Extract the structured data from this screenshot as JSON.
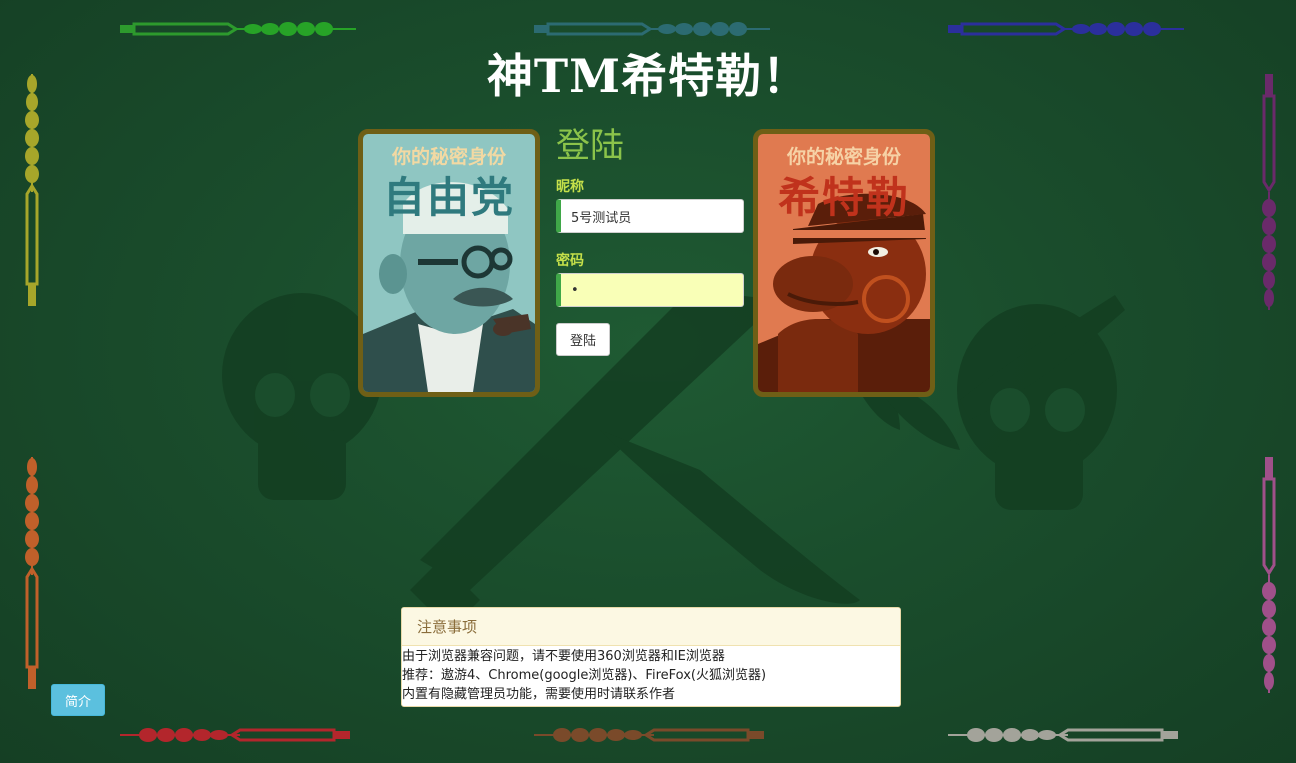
{
  "page": {
    "title": "神TM希特勒！"
  },
  "cards": {
    "liberal": {
      "subtitle": "你的秘密身份",
      "role": "自由党"
    },
    "hitler": {
      "subtitle": "你的秘密身份",
      "role": "希特勒"
    }
  },
  "login": {
    "heading": "登陆",
    "nickname_label": "昵称",
    "nickname_value": "5号测试员",
    "password_label": "密码",
    "password_value": "•",
    "submit_label": "登陆"
  },
  "notice": {
    "title": "注意事项",
    "lines": [
      "由于浏览器兼容问题，请不要使用360浏览器和IE浏览器",
      "推荐：遨游4、Chrome(google浏览器)、FireFox(火狐浏览器)",
      "内置有隐藏管理员功能，需要使用时请联系作者"
    ]
  },
  "intro_button": "简介",
  "colors": {
    "background": "#1a4d2c",
    "title": "#ffffff",
    "login_heading": "#8bc34a",
    "field_label": "#c5e04a",
    "input_accent": "#3fa748",
    "card_border": "#6f5f16",
    "liberal_card": "#8fc6c2",
    "hitler_card": "#e07a50",
    "intro_button": "#5bc0de"
  },
  "decorations": {
    "top": [
      "green-sword-laurel",
      "teal-sword-laurel",
      "blue-sword-laurel"
    ],
    "bottom": [
      "red-laurel-sword",
      "brown-laurel-sword",
      "grey-laurel-sword"
    ],
    "left": [
      "olive-laurel-sword",
      "orange-laurel-sword"
    ],
    "right": [
      "purple-sword-laurel",
      "pink-sword-laurel"
    ]
  }
}
